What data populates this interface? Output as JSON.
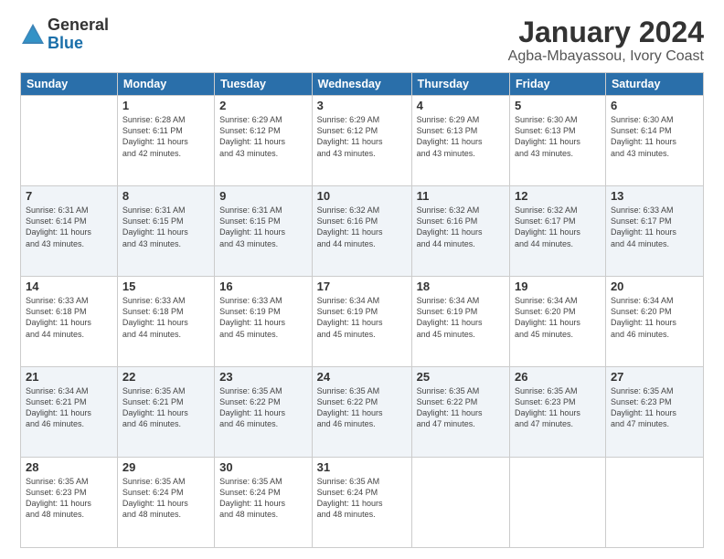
{
  "logo": {
    "general": "General",
    "blue": "Blue"
  },
  "title": "January 2024",
  "location": "Agba-Mbayassou, Ivory Coast",
  "days_of_week": [
    "Sunday",
    "Monday",
    "Tuesday",
    "Wednesday",
    "Thursday",
    "Friday",
    "Saturday"
  ],
  "weeks": [
    [
      {
        "day": "",
        "info": ""
      },
      {
        "day": "1",
        "info": "Sunrise: 6:28 AM\nSunset: 6:11 PM\nDaylight: 11 hours\nand 42 minutes."
      },
      {
        "day": "2",
        "info": "Sunrise: 6:29 AM\nSunset: 6:12 PM\nDaylight: 11 hours\nand 43 minutes."
      },
      {
        "day": "3",
        "info": "Sunrise: 6:29 AM\nSunset: 6:12 PM\nDaylight: 11 hours\nand 43 minutes."
      },
      {
        "day": "4",
        "info": "Sunrise: 6:29 AM\nSunset: 6:13 PM\nDaylight: 11 hours\nand 43 minutes."
      },
      {
        "day": "5",
        "info": "Sunrise: 6:30 AM\nSunset: 6:13 PM\nDaylight: 11 hours\nand 43 minutes."
      },
      {
        "day": "6",
        "info": "Sunrise: 6:30 AM\nSunset: 6:14 PM\nDaylight: 11 hours\nand 43 minutes."
      }
    ],
    [
      {
        "day": "7",
        "info": "Sunrise: 6:31 AM\nSunset: 6:14 PM\nDaylight: 11 hours\nand 43 minutes."
      },
      {
        "day": "8",
        "info": "Sunrise: 6:31 AM\nSunset: 6:15 PM\nDaylight: 11 hours\nand 43 minutes."
      },
      {
        "day": "9",
        "info": "Sunrise: 6:31 AM\nSunset: 6:15 PM\nDaylight: 11 hours\nand 43 minutes."
      },
      {
        "day": "10",
        "info": "Sunrise: 6:32 AM\nSunset: 6:16 PM\nDaylight: 11 hours\nand 44 minutes."
      },
      {
        "day": "11",
        "info": "Sunrise: 6:32 AM\nSunset: 6:16 PM\nDaylight: 11 hours\nand 44 minutes."
      },
      {
        "day": "12",
        "info": "Sunrise: 6:32 AM\nSunset: 6:17 PM\nDaylight: 11 hours\nand 44 minutes."
      },
      {
        "day": "13",
        "info": "Sunrise: 6:33 AM\nSunset: 6:17 PM\nDaylight: 11 hours\nand 44 minutes."
      }
    ],
    [
      {
        "day": "14",
        "info": "Sunrise: 6:33 AM\nSunset: 6:18 PM\nDaylight: 11 hours\nand 44 minutes."
      },
      {
        "day": "15",
        "info": "Sunrise: 6:33 AM\nSunset: 6:18 PM\nDaylight: 11 hours\nand 44 minutes."
      },
      {
        "day": "16",
        "info": "Sunrise: 6:33 AM\nSunset: 6:19 PM\nDaylight: 11 hours\nand 45 minutes."
      },
      {
        "day": "17",
        "info": "Sunrise: 6:34 AM\nSunset: 6:19 PM\nDaylight: 11 hours\nand 45 minutes."
      },
      {
        "day": "18",
        "info": "Sunrise: 6:34 AM\nSunset: 6:19 PM\nDaylight: 11 hours\nand 45 minutes."
      },
      {
        "day": "19",
        "info": "Sunrise: 6:34 AM\nSunset: 6:20 PM\nDaylight: 11 hours\nand 45 minutes."
      },
      {
        "day": "20",
        "info": "Sunrise: 6:34 AM\nSunset: 6:20 PM\nDaylight: 11 hours\nand 46 minutes."
      }
    ],
    [
      {
        "day": "21",
        "info": "Sunrise: 6:34 AM\nSunset: 6:21 PM\nDaylight: 11 hours\nand 46 minutes."
      },
      {
        "day": "22",
        "info": "Sunrise: 6:35 AM\nSunset: 6:21 PM\nDaylight: 11 hours\nand 46 minutes."
      },
      {
        "day": "23",
        "info": "Sunrise: 6:35 AM\nSunset: 6:22 PM\nDaylight: 11 hours\nand 46 minutes."
      },
      {
        "day": "24",
        "info": "Sunrise: 6:35 AM\nSunset: 6:22 PM\nDaylight: 11 hours\nand 46 minutes."
      },
      {
        "day": "25",
        "info": "Sunrise: 6:35 AM\nSunset: 6:22 PM\nDaylight: 11 hours\nand 47 minutes."
      },
      {
        "day": "26",
        "info": "Sunrise: 6:35 AM\nSunset: 6:23 PM\nDaylight: 11 hours\nand 47 minutes."
      },
      {
        "day": "27",
        "info": "Sunrise: 6:35 AM\nSunset: 6:23 PM\nDaylight: 11 hours\nand 47 minutes."
      }
    ],
    [
      {
        "day": "28",
        "info": "Sunrise: 6:35 AM\nSunset: 6:23 PM\nDaylight: 11 hours\nand 48 minutes."
      },
      {
        "day": "29",
        "info": "Sunrise: 6:35 AM\nSunset: 6:24 PM\nDaylight: 11 hours\nand 48 minutes."
      },
      {
        "day": "30",
        "info": "Sunrise: 6:35 AM\nSunset: 6:24 PM\nDaylight: 11 hours\nand 48 minutes."
      },
      {
        "day": "31",
        "info": "Sunrise: 6:35 AM\nSunset: 6:24 PM\nDaylight: 11 hours\nand 48 minutes."
      },
      {
        "day": "",
        "info": ""
      },
      {
        "day": "",
        "info": ""
      },
      {
        "day": "",
        "info": ""
      }
    ]
  ]
}
